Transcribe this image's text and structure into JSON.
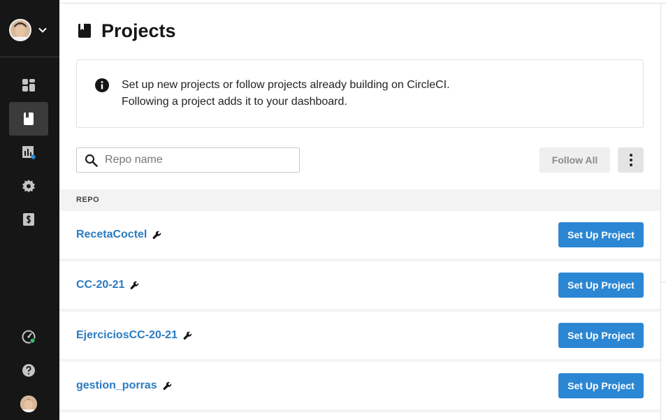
{
  "page": {
    "title": "Projects",
    "info_lines": [
      "Set up new projects or follow projects already building on CircleCI.",
      "Following a project adds it to your dashboard."
    ]
  },
  "search": {
    "placeholder": "Repo name",
    "value": ""
  },
  "toolbar": {
    "follow_all_label": "Follow All"
  },
  "table": {
    "header": "REPO",
    "setup_label": "Set Up Project",
    "rows": [
      {
        "name": "RecetaCoctel"
      },
      {
        "name": "CC-20-21"
      },
      {
        "name": "EjerciciosCC-20-21"
      },
      {
        "name": "gestion_porras"
      }
    ]
  },
  "sidebar": {
    "items": [
      {
        "icon": "dashboard-icon"
      },
      {
        "icon": "projects-icon",
        "active": true
      },
      {
        "icon": "insights-icon"
      },
      {
        "icon": "gear-icon"
      },
      {
        "icon": "plan-billing-icon"
      }
    ],
    "bottom": [
      {
        "icon": "status-icon"
      },
      {
        "icon": "help-icon"
      },
      {
        "icon": "avatar"
      }
    ]
  },
  "colors": {
    "sidebar_bg": "#161616",
    "link": "#2a7bc2",
    "primary_button": "#2b87d3",
    "status_dot_blue": "#2b87d3",
    "status_dot_green": "#2ec866"
  }
}
